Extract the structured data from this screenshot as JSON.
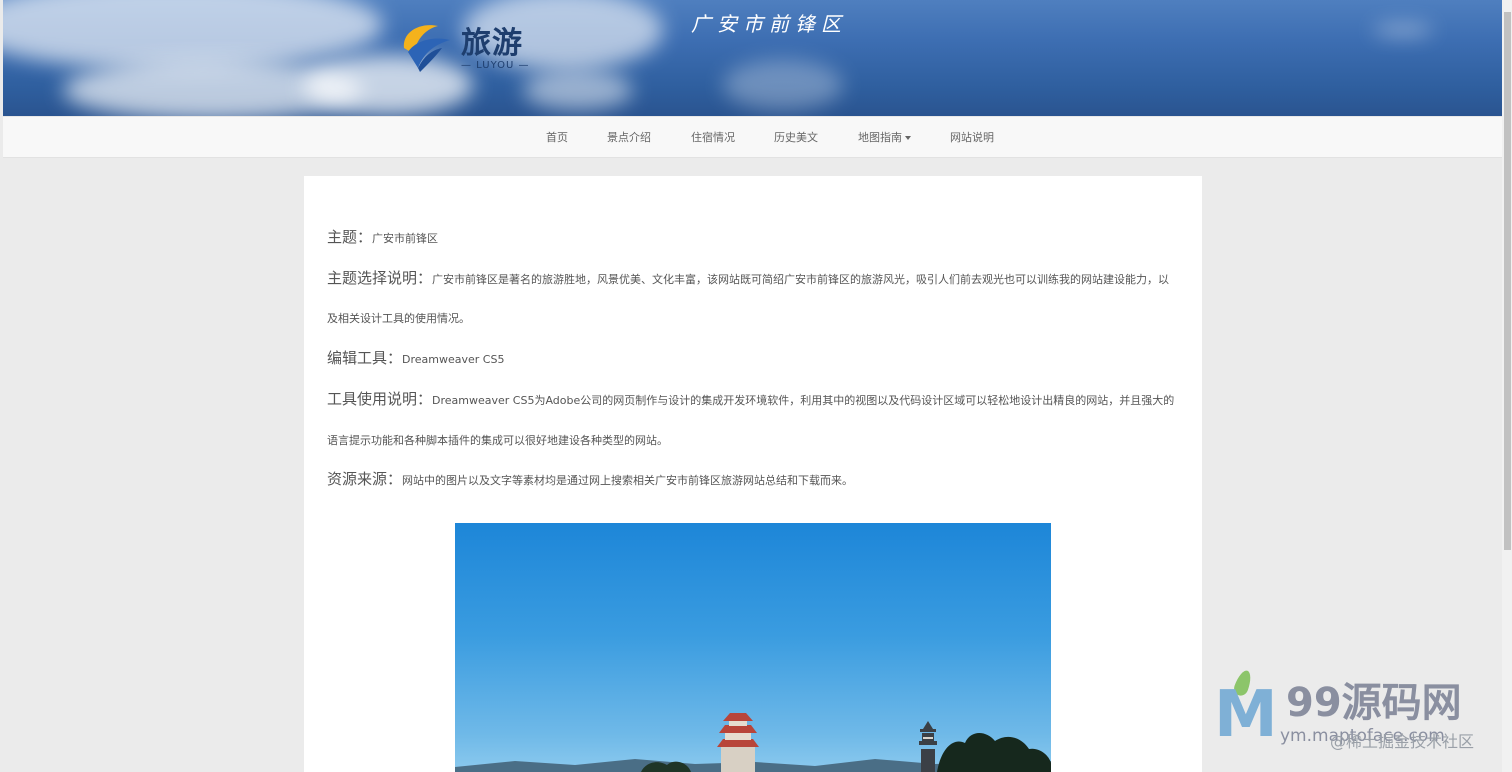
{
  "header": {
    "logo_text": "旅游",
    "logo_sub": "— LUYOU —",
    "site_title": "广安市前锋区"
  },
  "nav": {
    "items": [
      "首页",
      "景点介绍",
      "住宿情况",
      "历史美文",
      "地图指南",
      "网站说明"
    ]
  },
  "content": {
    "topic_label": "主题：",
    "topic_value": "广安市前锋区",
    "reason_label": "主题选择说明：",
    "reason_line1": "广安市前锋区是著名的旅游胜地，风景优美、文化丰富，该网站既可简绍广安市前锋区的旅游风光，吸引人们前去观光也可以训练我的网站建设能力，以",
    "reason_line2": "及相关设计工具的使用情况。",
    "editor_label": "编辑工具：",
    "editor_value": "Dreamweaver CS5",
    "usage_label": "工具使用说明：",
    "usage_line1": "Dreamweaver CS5为Adobe公司的网页制作与设计的集成开发环境软件，利用其中的视图以及代码设计区域可以轻松地设计出精良的网站，并且强大的",
    "usage_line2": "语言提示功能和各种脚本插件的集成可以很好地建设各种类型的网站。",
    "source_label": "资源来源：",
    "source_value": "网站中的图片以及文字等素材均是通过网上搜索相关广安市前锋区旅游网站总结和下载而来。"
  },
  "watermark": {
    "brand": "99源码网",
    "url": "ym.maptoface.com",
    "credit": "@稀土掘金技术社区"
  }
}
